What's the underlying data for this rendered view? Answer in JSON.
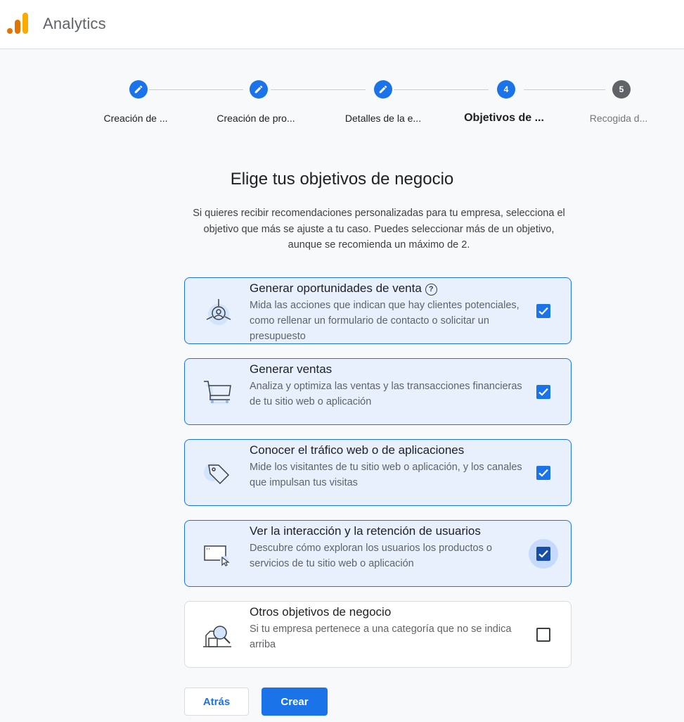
{
  "app": {
    "title": "Analytics"
  },
  "steps": [
    {
      "label": "Creación de ...",
      "state": "done"
    },
    {
      "label": "Creación de pro...",
      "state": "done"
    },
    {
      "label": "Detalles de la e...",
      "state": "done"
    },
    {
      "label": "Objetivos de ...",
      "number": "4",
      "state": "active"
    },
    {
      "label": "Recogida d...",
      "number": "5",
      "state": "pending"
    }
  ],
  "heading": "Elige tus objetivos de negocio",
  "intro": "Si quieres recibir recomendaciones personalizadas para tu empresa, selecciona el objetivo que más se ajuste a tu caso. Puedes seleccionar más de un objetivo, aunque se recomienda un máximo de 2.",
  "objectives": [
    {
      "title": "Generar oportunidades de venta",
      "help_icon": "help-icon",
      "icon": "leads-icon",
      "description": "Mida las acciones que indican que hay clientes potenciales, como rellenar un formulario de contacto o solicitar un presupuesto",
      "checked": true
    },
    {
      "title": "Generar ventas",
      "icon": "cart-icon",
      "description": "Analiza y optimiza las ventas y las transacciones financieras de tu sitio web o aplicación",
      "checked": true
    },
    {
      "title": "Conocer el tráfico web o de aplicaciones",
      "icon": "tag-icon",
      "description": "Mide los visitantes de tu sitio web o aplicación, y los canales que impulsan tus visitas",
      "checked": true
    },
    {
      "title": "Ver la interacción y la retención de usuarios",
      "icon": "browser-cursor-icon",
      "description": "Descubre cómo exploran los usuarios los productos o servicios de tu sitio web o aplicación",
      "checked": true,
      "focused": true
    },
    {
      "title": "Otros objetivos de negocio",
      "icon": "magnifier-icon",
      "description": "Si tu empresa pertenece a una categoría que no se indica arriba",
      "checked": false
    }
  ],
  "buttons": {
    "back": "Atrás",
    "create": "Crear"
  },
  "colors": {
    "primary": "#1a73e8",
    "selected_bg": "#e8f0fe",
    "logo_orange": "#f9ab00",
    "logo_dark_orange": "#e37400"
  }
}
